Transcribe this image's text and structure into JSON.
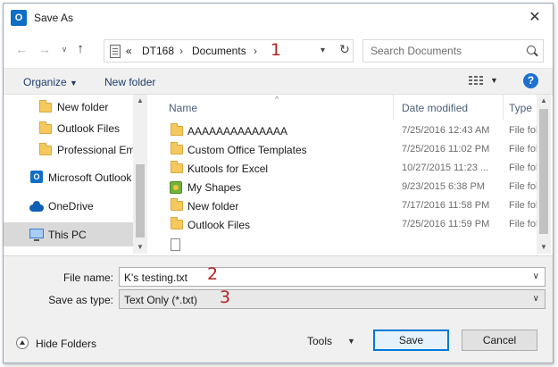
{
  "window": {
    "title": "Save As",
    "app_icon_letter": "O"
  },
  "address": {
    "history_glyph": "∨",
    "prefix": "«",
    "crumbs": [
      "DT168",
      "Documents"
    ],
    "callout": "1"
  },
  "search": {
    "placeholder": "Search Documents"
  },
  "toolbar": {
    "organize": "Organize",
    "new_folder": "New folder",
    "help": "?"
  },
  "nav": {
    "items": [
      {
        "label": "New folder",
        "icon": "folder-icon"
      },
      {
        "label": "Outlook Files",
        "icon": "folder-icon"
      },
      {
        "label": "Professional Ema",
        "icon": "folder-icon"
      },
      {
        "label": "Microsoft Outlook",
        "icon": "outlook-icon"
      },
      {
        "label": "OneDrive",
        "icon": "cloud-icon"
      },
      {
        "label": "This PC",
        "icon": "pc-icon",
        "selected": true
      }
    ]
  },
  "files": {
    "columns": [
      "Name",
      "Date modified",
      "Type"
    ],
    "rows": [
      {
        "name": "AAAAAAAAAAAAAA",
        "date": "7/25/2016 12:43 AM",
        "type": "File fol",
        "icon": "folder-icon"
      },
      {
        "name": "Custom Office Templates",
        "date": "7/25/2016 11:02 PM",
        "type": "File fol",
        "icon": "folder-icon"
      },
      {
        "name": "Kutools for Excel",
        "date": "10/27/2015 11:23 ...",
        "type": "File fol",
        "icon": "folder-icon"
      },
      {
        "name": "My Shapes",
        "date": "9/23/2015 6:38 PM",
        "type": "File fol",
        "icon": "shapes-icon"
      },
      {
        "name": "New folder",
        "date": "7/17/2016 11:58 PM",
        "type": "File fol",
        "icon": "folder-icon"
      },
      {
        "name": "Outlook Files",
        "date": "7/25/2016 11:59 PM",
        "type": "File fol",
        "icon": "folder-icon"
      }
    ]
  },
  "form": {
    "file_name_label": "File name:",
    "file_name_value": "K's testing.txt",
    "file_name_callout": "2",
    "save_type_label": "Save as type:",
    "save_type_value": "Text Only (*.txt)",
    "save_type_callout": "3"
  },
  "footer": {
    "hide_folders": "Hide Folders",
    "tools": "Tools",
    "save": "Save",
    "cancel": "Cancel"
  }
}
